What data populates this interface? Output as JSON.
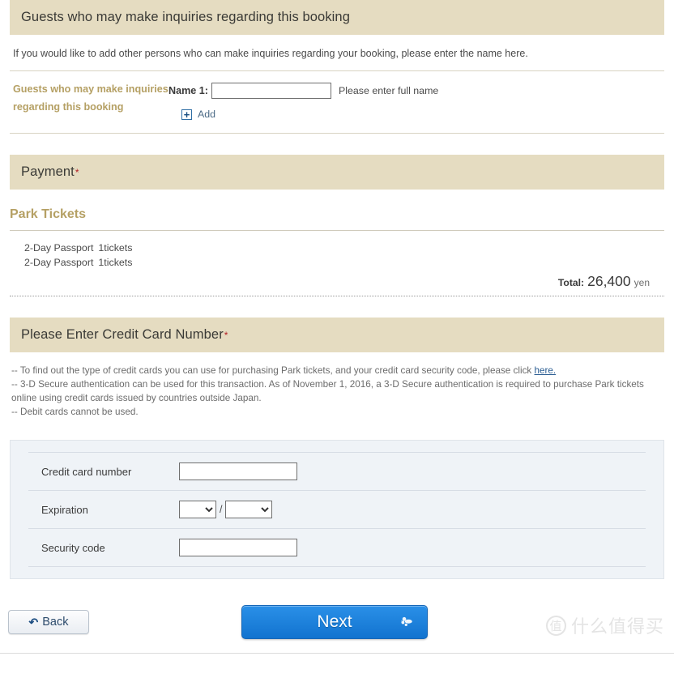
{
  "guests_section": {
    "header": "Guests who may make inquiries regarding this booking",
    "intro": "If you would like to add other persons who can make inquiries regarding your booking, please enter the name here.",
    "row_label": "Guests who may make inquiries regarding this booking",
    "name_label": "Name 1:",
    "name_value": "",
    "name_placeholder": "",
    "name_hint": "Please enter full name",
    "add_plus": "+",
    "add_label": "Add"
  },
  "payment_section": {
    "header": "Payment",
    "required_mark": "*",
    "sub_title": "Park Tickets",
    "tickets": [
      {
        "name": "2-Day Passport",
        "qty": "1tickets"
      },
      {
        "name": "2-Day Passport",
        "qty": "1tickets"
      }
    ],
    "total_label": "Total:",
    "total_amount": "26,400",
    "total_unit": "yen"
  },
  "credit_card_section": {
    "header": "Please Enter Credit Card Number",
    "required_mark": "*",
    "note_1_before": "-- To find out the type of credit cards you can use for purchasing Park tickets, and your credit card security code, please click",
    "note_1_link": "here.",
    "note_2": "-- 3-D Secure authentication can be used for this transaction. As of November 1, 2016, a 3-D Secure authentication is required to purchase Park tickets online using credit cards issued by countries outside Japan.",
    "note_3": "-- Debit cards cannot be used.",
    "fields": {
      "card_number_label": "Credit card number",
      "card_number_value": "",
      "expiration_label": "Expiration",
      "expiration_month_value": "",
      "expiration_year_value": "",
      "expiration_separator": "/",
      "security_code_label": "Security code",
      "security_code_value": ""
    }
  },
  "footer": {
    "back_label": "Back",
    "back_arrow": "↶",
    "next_label": "Next",
    "watermark_mark": "值",
    "watermark_text": "什么值得买"
  },
  "colors": {
    "section_bar": "#e5dcc1",
    "gold_text": "#b5a064",
    "required_red": "#b32025",
    "link_blue": "#2a5d92",
    "panel_bg": "#eff3f7",
    "next_button": "#1e86e0"
  }
}
